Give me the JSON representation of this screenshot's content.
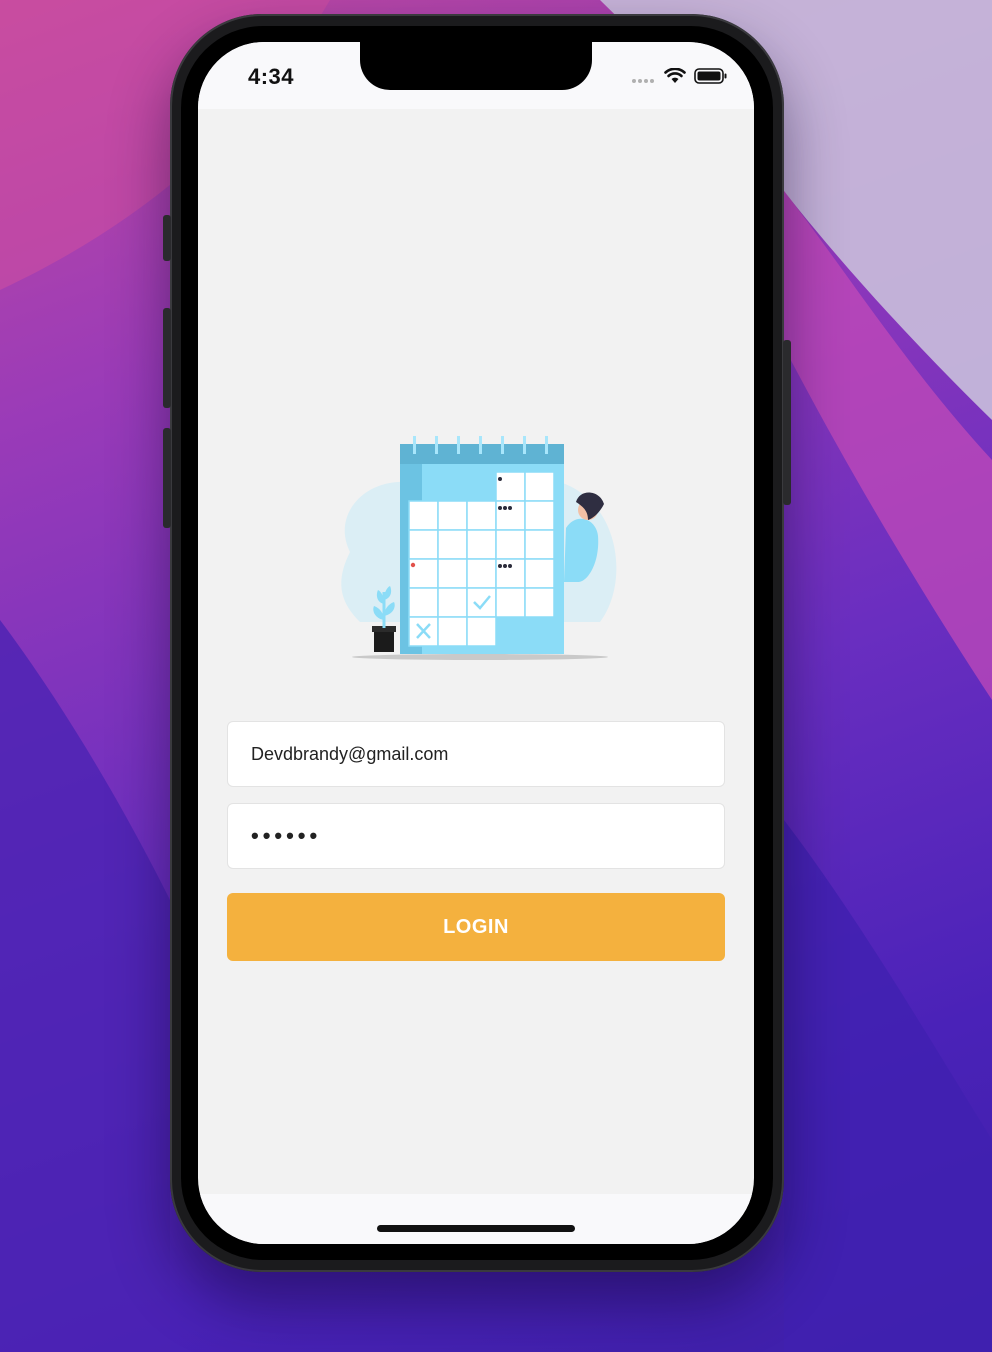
{
  "status_bar": {
    "time": "4:34",
    "icons": [
      "signal-dots-icon",
      "wifi-icon",
      "battery-icon"
    ]
  },
  "login_form": {
    "email_value": "Devdbrandy@gmail.com",
    "password_value": "••••••",
    "login_label": "LOGIN"
  },
  "colors": {
    "accent": "#f4b13e",
    "background": "#f2f2f2",
    "illustration_blue": "#8bdcf7"
  },
  "illustration": {
    "icon": "calendar-person-illustration"
  }
}
